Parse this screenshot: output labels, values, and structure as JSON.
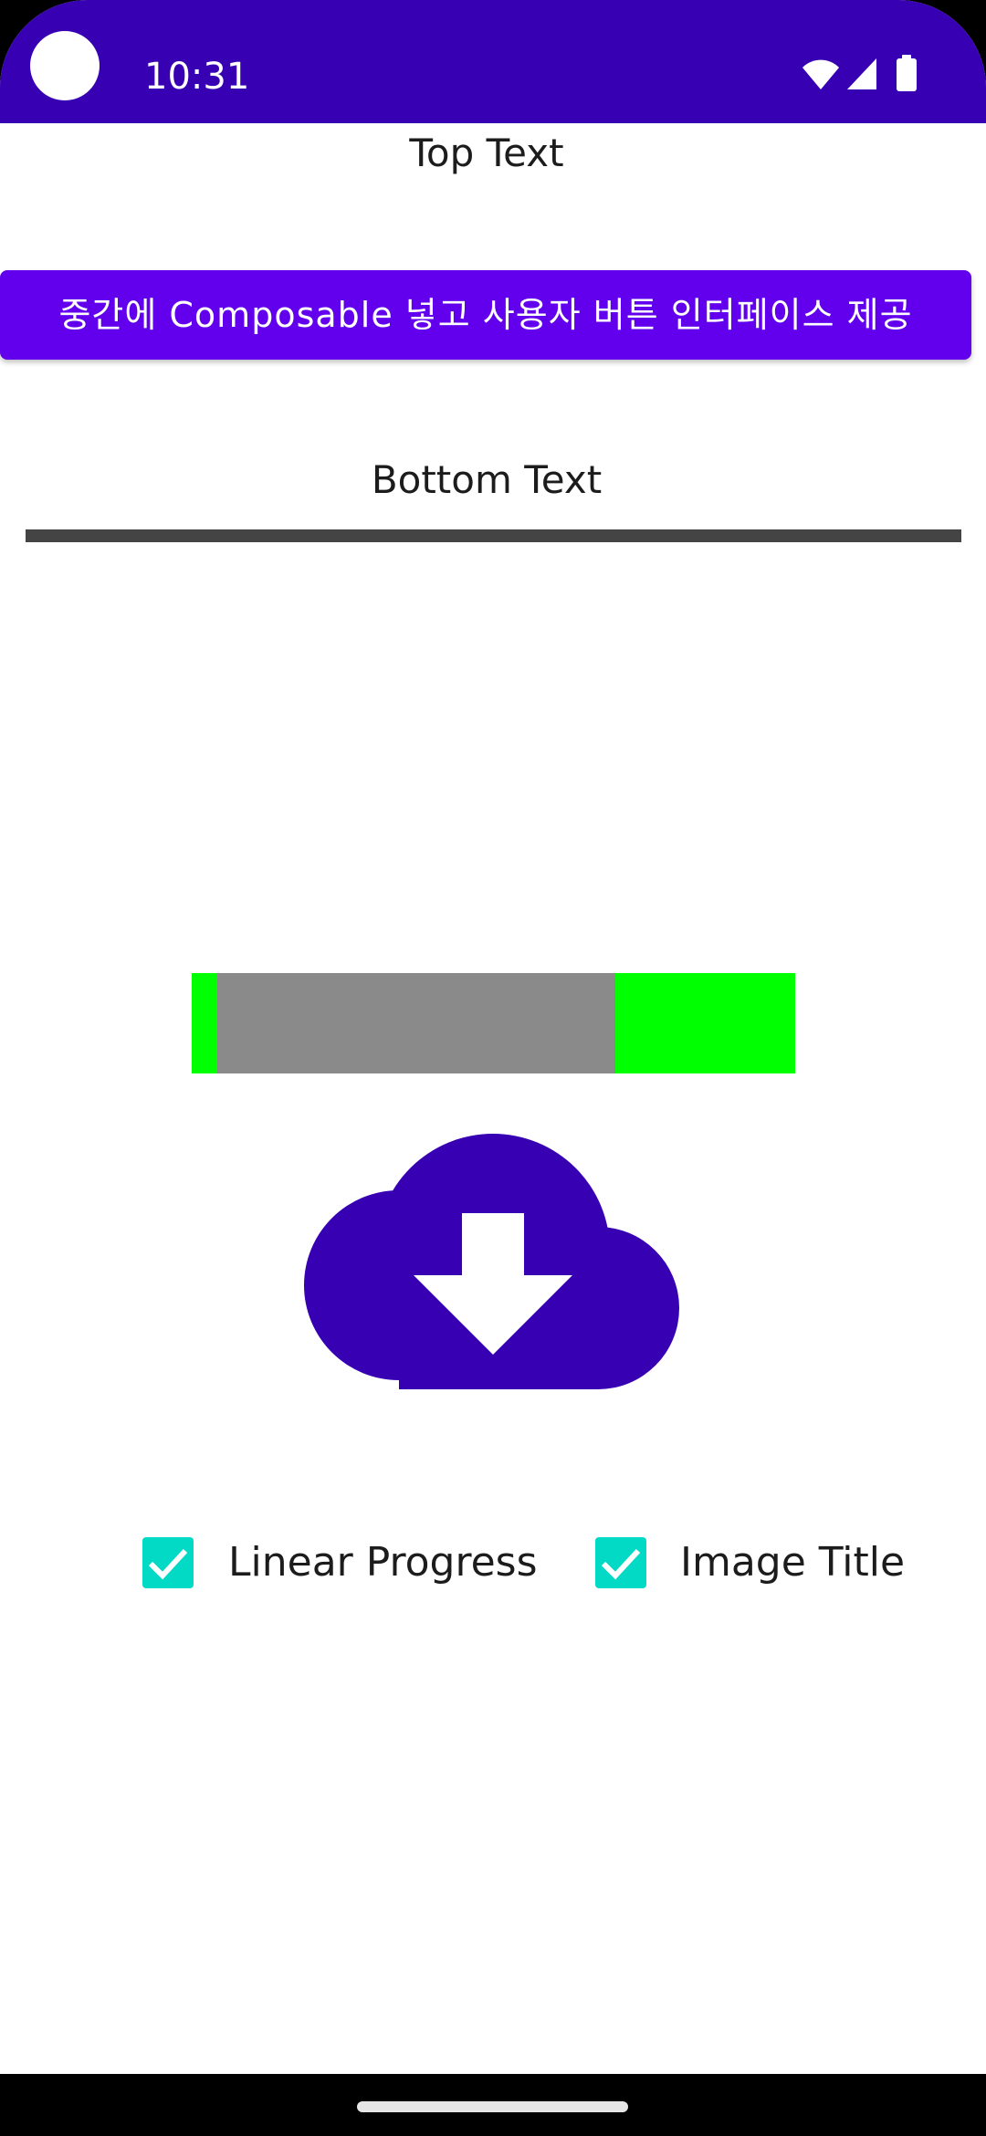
{
  "status_bar": {
    "time": "10:31",
    "icons": [
      "wifi-icon",
      "cell-signal-icon",
      "battery-icon"
    ],
    "background": "#3700b3"
  },
  "content": {
    "top_text": "Top Text",
    "button_label": "중간에 Composable 넣고 사용자 버튼 인터페이스 제공",
    "bottom_text": "Bottom Text",
    "progress": {
      "track_color": "#00ff00",
      "segment_color": "#8a8a8a"
    },
    "image": {
      "icon": "cloud-download-icon",
      "color": "#3700b3"
    },
    "checkboxes": [
      {
        "label": "Linear Progress",
        "checked": true
      },
      {
        "label": "Image Title",
        "checked": true
      }
    ],
    "accent_color": "#6200ee",
    "checkbox_color": "#03dac5"
  }
}
